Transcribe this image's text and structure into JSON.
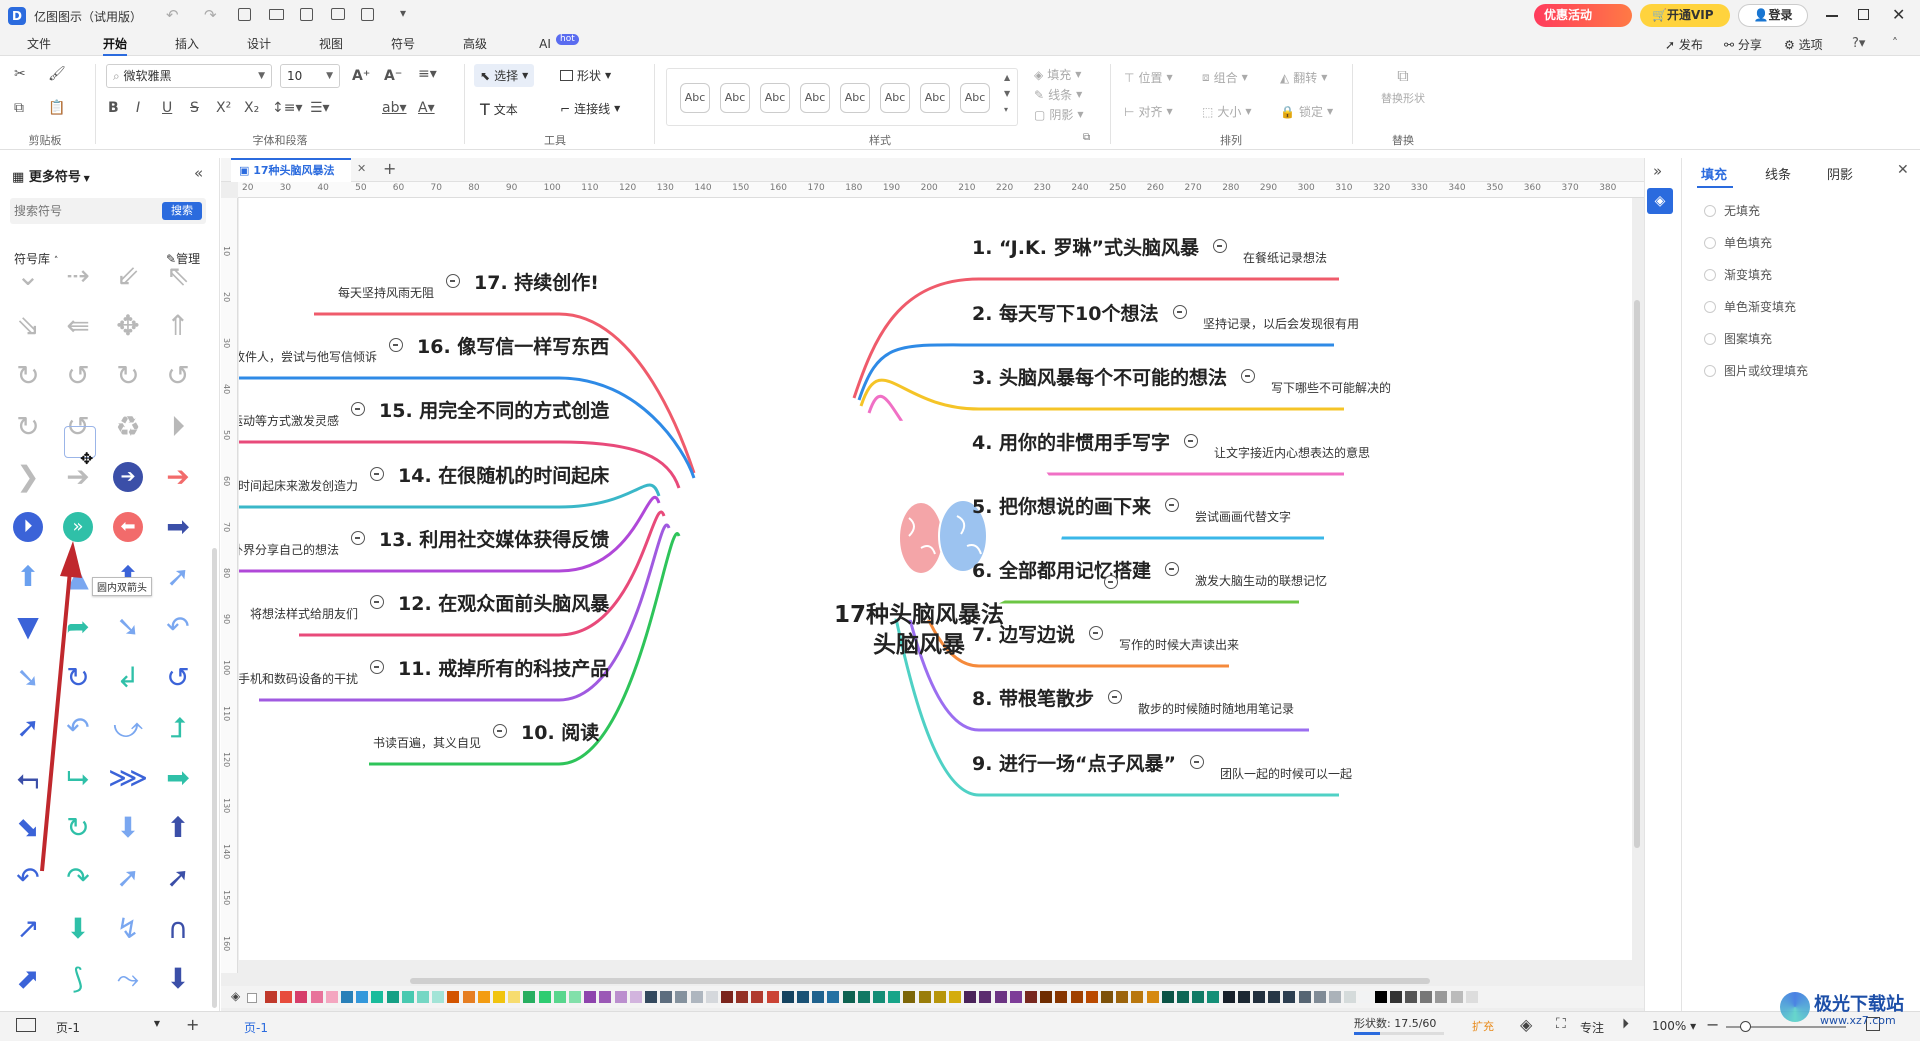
{
  "app": {
    "title": "亿图图示（试用版）",
    "promo_label": "优惠活动",
    "vip_label": "开通VIP",
    "login_label": "登录"
  },
  "menu": {
    "tabs": [
      "文件",
      "开始",
      "插入",
      "设计",
      "视图",
      "符号",
      "高级",
      "AI"
    ],
    "ai_badge": "hot",
    "right": {
      "publish": "发布",
      "share": "分享",
      "options": "选项"
    }
  },
  "ribbon": {
    "font_name": "微软雅黑",
    "font_size": "10",
    "select_label": "选择",
    "shape_label": "形状",
    "text_label": "文本",
    "connector_label": "连接线",
    "style_swatch_text": "Abc",
    "fill_label": "填充",
    "line_label": "线条",
    "shadow_label": "阴影",
    "position_label": "位置",
    "align_label": "对齐",
    "group_label": "组合",
    "size_label": "大小",
    "flip_label": "翻转",
    "lock_label": "锁定",
    "replace_shape_label": "替换形状",
    "groups": {
      "clipboard": "剪贴板",
      "font_para": "字体和段落",
      "tools": "工具",
      "styles": "样式",
      "arrange": "排列",
      "replace": "替换"
    }
  },
  "left_panel": {
    "title": "更多符号",
    "search_placeholder": "搜索符号",
    "search_button": "搜索",
    "library_label": "符号库",
    "manage_label": "管理",
    "tooltip": "圆内双箭头"
  },
  "doc_tab": {
    "name": "17种头脑风暴法"
  },
  "ruler": {
    "h_ticks": [
      "20",
      "30",
      "40",
      "50",
      "60",
      "70",
      "80",
      "90",
      "100",
      "110",
      "120",
      "130",
      "140",
      "150",
      "160",
      "170",
      "180",
      "190",
      "200",
      "210",
      "220",
      "230",
      "240",
      "250",
      "260",
      "270",
      "280",
      "290",
      "300",
      "310",
      "320",
      "330",
      "340",
      "350",
      "360",
      "370",
      "380"
    ],
    "v_ticks": [
      "10",
      "20",
      "30",
      "40",
      "50",
      "60",
      "70",
      "80",
      "90",
      "100",
      "110",
      "120",
      "130",
      "140",
      "150",
      "160"
    ]
  },
  "mindmap": {
    "center_line1": "17种头脑风暴法",
    "center_line2": "头脑风暴",
    "right_topics": [
      {
        "title": "1. “J.K. 罗琳”式头脑风暴",
        "note": "在餐纸记录想法",
        "color": "#ef5b6b"
      },
      {
        "title": "2. 每天写下10个想法",
        "note": "坚持记录，以后会发现很有用",
        "color": "#2e8ae6"
      },
      {
        "title": "3. 头脑风暴每个不可能的想法",
        "note": "写下哪些不可能解决的",
        "color": "#f5c427"
      },
      {
        "title": "4. 用你的非惯用手写字",
        "note": "让文字接近内心想表达的意思",
        "color": "#f070c5"
      },
      {
        "title": "5. 把你想说的画下来",
        "note": "尝试画画代替文字",
        "color": "#3ab7e8"
      },
      {
        "title": "6. 全部都用记忆搭建",
        "note": "激发大脑生动的联想记忆",
        "color": "#6cc644"
      },
      {
        "title": "7. 边写边说",
        "note": "写作的时候大声读出来",
        "color": "#f58a3b"
      },
      {
        "title": "8. 带根笔散步",
        "note": "散步的时候随时随地用笔记录",
        "color": "#9b6ef0"
      },
      {
        "title": "9. 进行一场“点子风暴”",
        "note": "团队一起的时候可以一起",
        "color": "#4fd1c5"
      }
    ],
    "left_topics": [
      {
        "title": "17. 持续创作!",
        "note": "每天坚持风雨无阻",
        "color": "#ef5b6b"
      },
      {
        "title": "16. 像写信一样写东西",
        "note": "虚拟一位收件人，尝试与他写信倾诉",
        "color": "#2e8ae6"
      },
      {
        "title": "15. 用完全不同的方式创造",
        "note": "用音乐、运动等方式激发灵感",
        "color": "#e84a7a"
      },
      {
        "title": "14. 在很随机的时间起床",
        "note": "在不同时间起床来激发创造力",
        "color": "#3ab7c8"
      },
      {
        "title": "13. 利用社交媒体获得反馈",
        "note": "主动向外界分享自己的想法",
        "color": "#b048d8"
      },
      {
        "title": "12. 在观众面前头脑风暴",
        "note": "将想法样式给朋友们",
        "color": "#e84a7a"
      },
      {
        "title": "11. 戒掉所有的科技产品",
        "note": "远离手机和数码设备的干扰",
        "color": "#a05ae0"
      },
      {
        "title": "10. 阅读",
        "note": "书读百遍，其义自见",
        "color": "#2ec45a"
      }
    ]
  },
  "right_panel": {
    "tabs": [
      "填充",
      "线条",
      "阴影"
    ],
    "options": [
      "无填充",
      "单色填充",
      "渐变填充",
      "单色渐变填充",
      "图案填充",
      "图片或纹理填充"
    ]
  },
  "status": {
    "page_selector": "页-1",
    "page_tab": "页-1",
    "shape_count": "形状数: 17.5/60",
    "expand": "扩充",
    "focus": "专注",
    "zoom": "100%"
  },
  "watermark": {
    "text": "极光下载站",
    "url": "www.xz7.com"
  },
  "palette": [
    "#c0392b",
    "#e74c3c",
    "#d63e6b",
    "#e8739b",
    "#f4a6c0",
    "#2980b9",
    "#3498db",
    "#1abc9c",
    "#16a085",
    "#48c9b0",
    "#76d7c4",
    "#a3e4d7",
    "#d35400",
    "#e67e22",
    "#f39c12",
    "#f1c40f",
    "#f7dc6f",
    "#27ae60",
    "#2ecc71",
    "#58d68d",
    "#82e0aa",
    "#8e44ad",
    "#9b59b6",
    "#bb8fce",
    "#d2b4de",
    "#34495e",
    "#5d6d7e",
    "#85929e",
    "#aeb6bf",
    "#d5d8dc",
    "#7b241c",
    "#943126",
    "#b03a2e",
    "#cb4335",
    "#154360",
    "#1a5276",
    "#1f618d",
    "#2471a3",
    "#0e6251",
    "#117864",
    "#138d75",
    "#17a589",
    "#7d6608",
    "#9a7d0a",
    "#b7950b",
    "#d4ac0d",
    "#4a235a",
    "#5b2c6f",
    "#6c3483",
    "#7d3c98",
    "#78281f",
    "#6e2c00",
    "#873600",
    "#a04000",
    "#ba4a00",
    "#7e5109",
    "#9c640c",
    "#b9770e",
    "#d68910",
    "#0b5345",
    "#0e6655",
    "#117a65",
    "#148f77",
    "#17202a",
    "#1c2833",
    "#212f3d",
    "#273746",
    "#2c3e50",
    "#566573",
    "#808b96",
    "#abb2b9",
    "#d5dbdb",
    "#f2f3f4",
    "#000000",
    "#333333",
    "#555555",
    "#777777",
    "#999999",
    "#bbbbbb",
    "#dddddd"
  ]
}
